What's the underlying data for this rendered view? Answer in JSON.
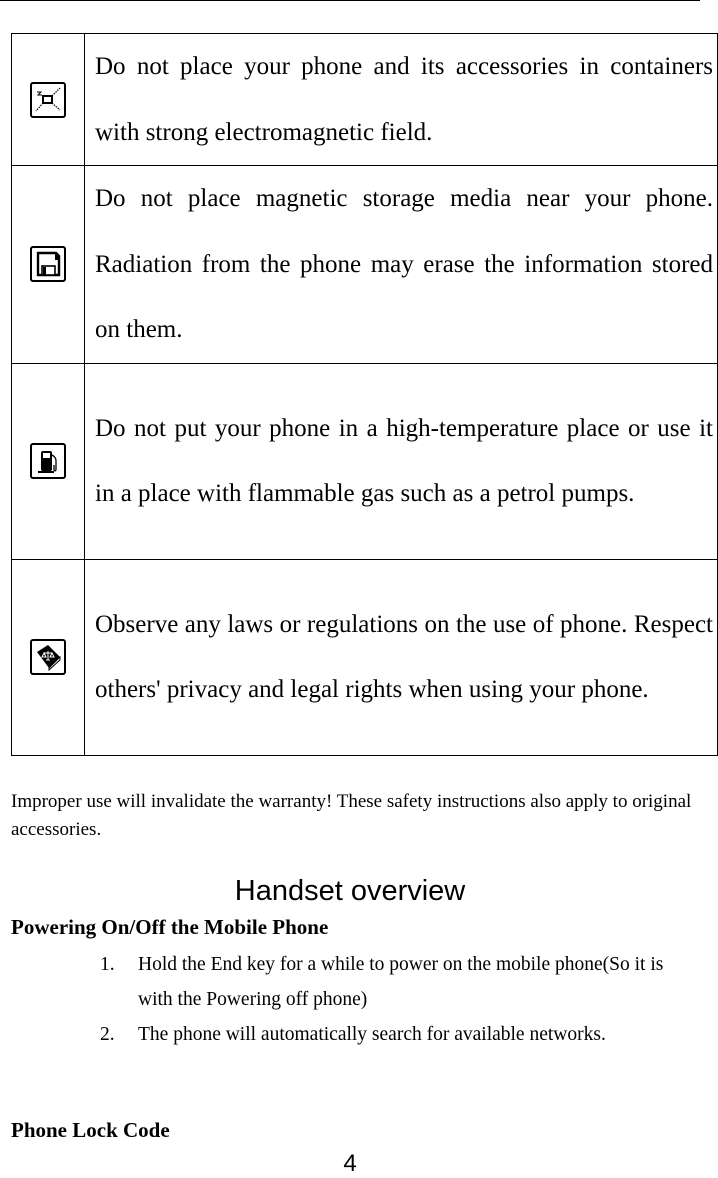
{
  "page": {
    "number": "4"
  },
  "safety_table": {
    "rows": [
      {
        "icon": "electromagnetic-field-icon",
        "text": "Do not place your phone and its accessories in containers with strong electromagnetic field."
      },
      {
        "icon": "floppy-disk-icon",
        "text": "Do not place magnetic storage media near your phone. Radiation from the phone may erase the information stored on them."
      },
      {
        "icon": "fuel-pump-icon",
        "text": "Do not put your phone in a high-temperature place or use it in a place with flammable gas such as a petrol pumps."
      },
      {
        "icon": "law-book-icon",
        "text": "Observe any laws or regulations on the use of phone. Respect others' privacy and legal rights when using your phone."
      }
    ]
  },
  "note": "Improper use will invalidate the warranty! These safety instructions also apply to original accessories.",
  "section": {
    "title": "Handset overview",
    "subsections": [
      {
        "heading": "Powering On/Off the Mobile Phone",
        "steps": [
          {
            "num": "1.",
            "text": "Hold the End key for a while to power on the mobile phone(So it is with the Powering off phone)"
          },
          {
            "num": "2.",
            "text": "The phone will automatically search for available networks."
          }
        ]
      },
      {
        "heading": "Phone Lock Code"
      }
    ]
  }
}
